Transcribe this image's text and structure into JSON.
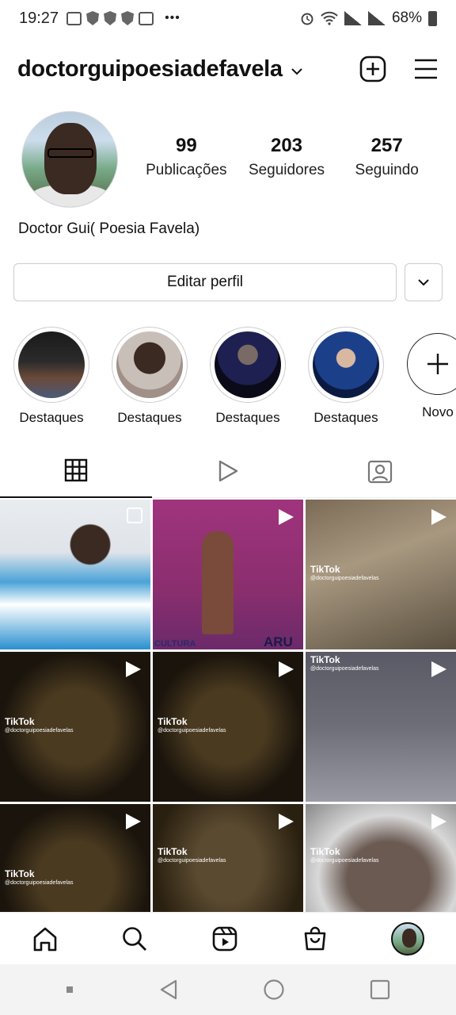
{
  "status_bar": {
    "time": "19:27",
    "battery": "68%"
  },
  "header": {
    "username": "doctorguipoesiadefavela"
  },
  "profile": {
    "display_name": "Doctor Gui( Poesia Favela)",
    "stats": [
      {
        "count": "99",
        "label": "Publicações"
      },
      {
        "count": "203",
        "label": "Seguidores"
      },
      {
        "count": "257",
        "label": "Seguindo"
      }
    ],
    "edit_label": "Editar perfil"
  },
  "highlights": [
    {
      "label": "Destaques"
    },
    {
      "label": "Destaques"
    },
    {
      "label": "Destaques"
    },
    {
      "label": "Destaques"
    },
    {
      "label": "Novo"
    }
  ],
  "grid": {
    "tiktok_brand": "TikTok",
    "tiktok_handle": "@doctorguipoesiadefavelas",
    "overlay_text": [
      "CULTURA",
      "ARU"
    ]
  }
}
